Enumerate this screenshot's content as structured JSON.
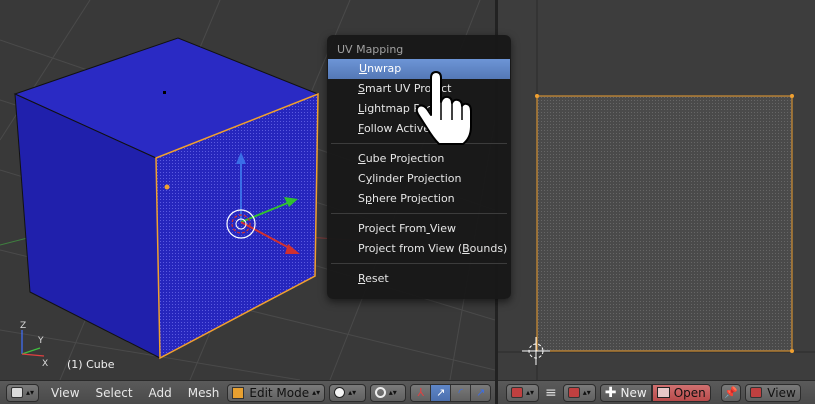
{
  "viewport3d": {
    "object_label": "(1) Cube",
    "axis_labels": {
      "x": "X",
      "y": "Y",
      "z": "Z"
    }
  },
  "uv_menu": {
    "title": "UV Mapping",
    "sections": [
      [
        {
          "label": "Unwrap",
          "u": 0,
          "active": true
        },
        {
          "label": "Smart UV Project",
          "u": 0,
          "active": false
        },
        {
          "label": "Lightmap Pack",
          "u": 0,
          "active": false
        },
        {
          "label": "Follow Active Quads",
          "u": 0,
          "active": false
        }
      ],
      [
        {
          "label": "Cube Projection",
          "u": 0,
          "active": false
        },
        {
          "label": "Cylinder Projection",
          "u": 1,
          "active": false
        },
        {
          "label": "Sphere Projection",
          "u": 1,
          "active": false
        }
      ],
      [
        {
          "label": "Project From View",
          "u": 12,
          "active": false
        },
        {
          "label": "Project from View (Bounds)",
          "u": 19,
          "active": false
        }
      ],
      [
        {
          "label": "Reset",
          "u": 0,
          "active": false
        }
      ]
    ]
  },
  "header_3d": {
    "menus": [
      "View",
      "Select",
      "Add",
      "Mesh"
    ],
    "mode": "Edit Mode"
  },
  "header_uv": {
    "new_label": "New",
    "open_label": "Open",
    "view_label": "View"
  },
  "colors": {
    "cube_face": "#2323b8",
    "selected_edge": "#f0a030",
    "menu_highlight": "#5f86c7"
  }
}
